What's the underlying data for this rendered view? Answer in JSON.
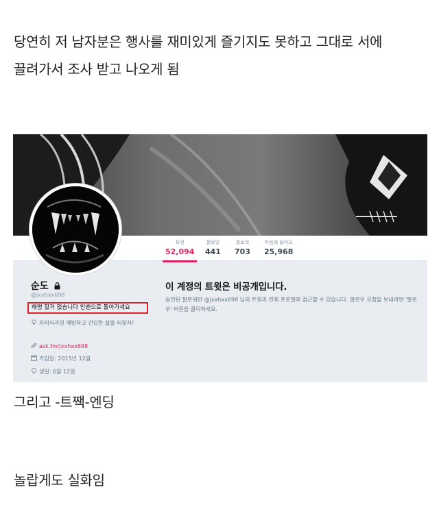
{
  "post": {
    "line1": "당연히 저 남자분은 행사를 재미있게 즐기지도 못하고 그대로 서에",
    "line2": "끌려가서 조사 받고 나오게 됨",
    "line3": "그리고 -트짹-엔딩",
    "line4": "놀랍게도 실화임"
  },
  "profile": {
    "stats": [
      {
        "label": "트윗",
        "value": "52,094"
      },
      {
        "label": "팔로잉",
        "value": "441"
      },
      {
        "label": "팔로워",
        "value": "703"
      },
      {
        "label": "마음에 들어요",
        "value": "25,968"
      }
    ],
    "name": "순도",
    "handle": "@jxxhxx698",
    "bio": "해명 할거 없습니다 인벤으로 돌아가세요",
    "location": "자의식과잉 예방하고 건강한 삶을 되찾자!",
    "website": "ask.fm/jxxhxx698",
    "joined": "가입일: 2015년 12월",
    "birthday": "생일: 6월 12일",
    "private_title": "이 계정의 트윗은 비공개입니다.",
    "private_desc": "승인된 팔로워만 @jxxhxx698 님의 트윗과 전체 프로필에 접근할 수 있습니다. 팔로우 요청을 보내려면 '팔로우' 버튼을 클릭하세요.",
    "icons": {
      "lock": "lock-icon",
      "location": "location-pin-icon",
      "link": "link-icon",
      "calendar": "calendar-icon",
      "birthday": "balloon-icon"
    },
    "colors": {
      "accent": "#e0245e",
      "highlight_box": "#e0202b"
    }
  }
}
